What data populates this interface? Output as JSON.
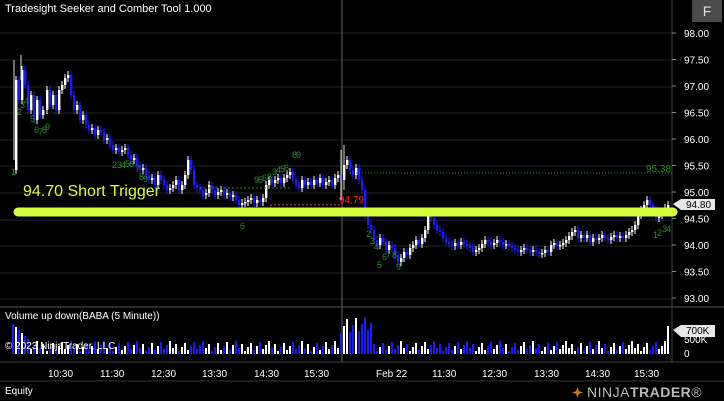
{
  "window": {
    "title": "Tradesight Seeker and Comber Tool 1.000",
    "format_button": "F"
  },
  "price_panel": {
    "axis_labels": [
      "98.00",
      "97.50",
      "97.00",
      "96.50",
      "96.00",
      "95.50",
      "95.00",
      "94.50",
      "94.00",
      "93.50",
      "93.00"
    ],
    "current_price_label": "94.80",
    "trigger_label": "94.70 Short Trigger",
    "level_label": "95.38",
    "red_label": "94.79"
  },
  "volume_panel": {
    "title": "Volume up down(BABA (5 Minute))",
    "copyright": "© 2023 NinjaTrader, LLC",
    "axis_labels": [
      "500K",
      "0"
    ],
    "current_volume_label": "700K"
  },
  "time_axis": {
    "labels": [
      "10:30",
      "11:30",
      "12:30",
      "13:30",
      "14:30",
      "15:30",
      "Feb 22",
      "11:30",
      "12:30",
      "13:30",
      "14:30",
      "15:30"
    ]
  },
  "tabs": {
    "equity": "Equity"
  },
  "logo": {
    "text_1": "NINJA",
    "text_2": "TRADER",
    "suffix": "®"
  },
  "colors": {
    "background": "#000000",
    "up_candle": "#ffffff",
    "down_candle": "#1a1aff",
    "trigger_line": "#d4ff3a",
    "counter_text": "#2e8b2e",
    "red_text": "#ff2222",
    "axis_text": "#ffffff"
  }
}
